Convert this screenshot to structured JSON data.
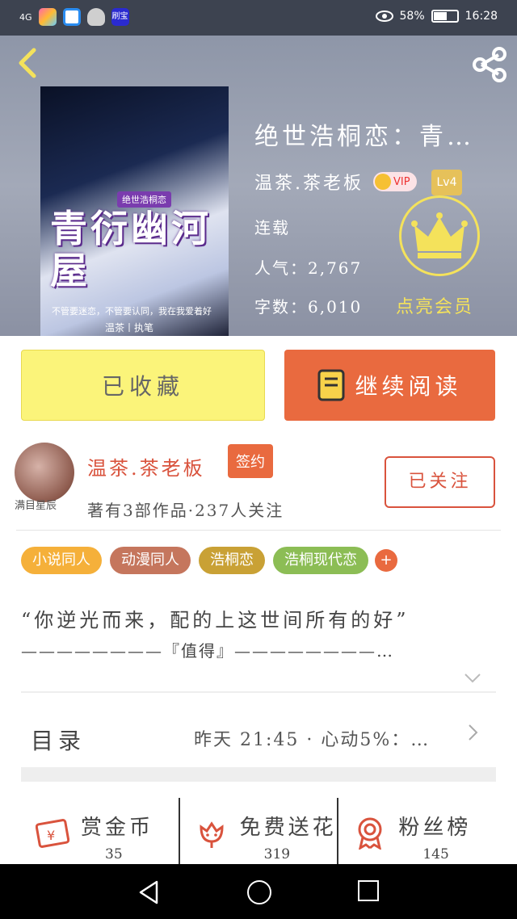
{
  "status_bar": {
    "signal": "4G",
    "app_badge": "刷宝",
    "battery": "58%",
    "battery_level": 0.58,
    "time": "16:28"
  },
  "header": {
    "cover": {
      "series_tag": "绝世浩桐恋",
      "title": "青衍幽河屋",
      "tagline": "不管要迷恋，不管要认同，我在我爱着好",
      "author": "温茶丨执笔"
    },
    "book_title": "绝世浩桐恋：青…",
    "author": "温茶.茶老板",
    "vip": "VIP",
    "level": "Lv4",
    "status": "连载",
    "popularity": "人气：2,767",
    "word_count": "字数：6,010",
    "light_member": "点亮会员"
  },
  "actions": {
    "collect": "已收藏",
    "read": "继续阅读"
  },
  "author_card": {
    "name": "温茶.茶老板",
    "signed": "签约",
    "stats": "著有3部作品·237人关注",
    "follow": "已关注",
    "avatar_caption": "满目星辰"
  },
  "tags": [
    "小说同人",
    "动漫同人",
    "浩桐恋",
    "浩桐现代恋"
  ],
  "tag_add": "+",
  "intro": {
    "line1": "“你逆光而来，配的上这世间所有的好”",
    "line2": "————————『值得』————————…"
  },
  "catalog": {
    "label": "目录",
    "update": "昨天 21:45 · 心动5%：…"
  },
  "bottom_stats": [
    {
      "label": "赏金币",
      "value": "35",
      "icon": "coin-envelope-icon"
    },
    {
      "label": "免费送花",
      "value": "319",
      "icon": "flower-icon"
    },
    {
      "label": "粉丝榜",
      "value": "145",
      "icon": "medal-icon"
    }
  ],
  "colors": {
    "accent": "#e96a3f",
    "collect": "#fbf47a",
    "author_red": "#d9533d",
    "crown_gold": "#f4e25b"
  }
}
